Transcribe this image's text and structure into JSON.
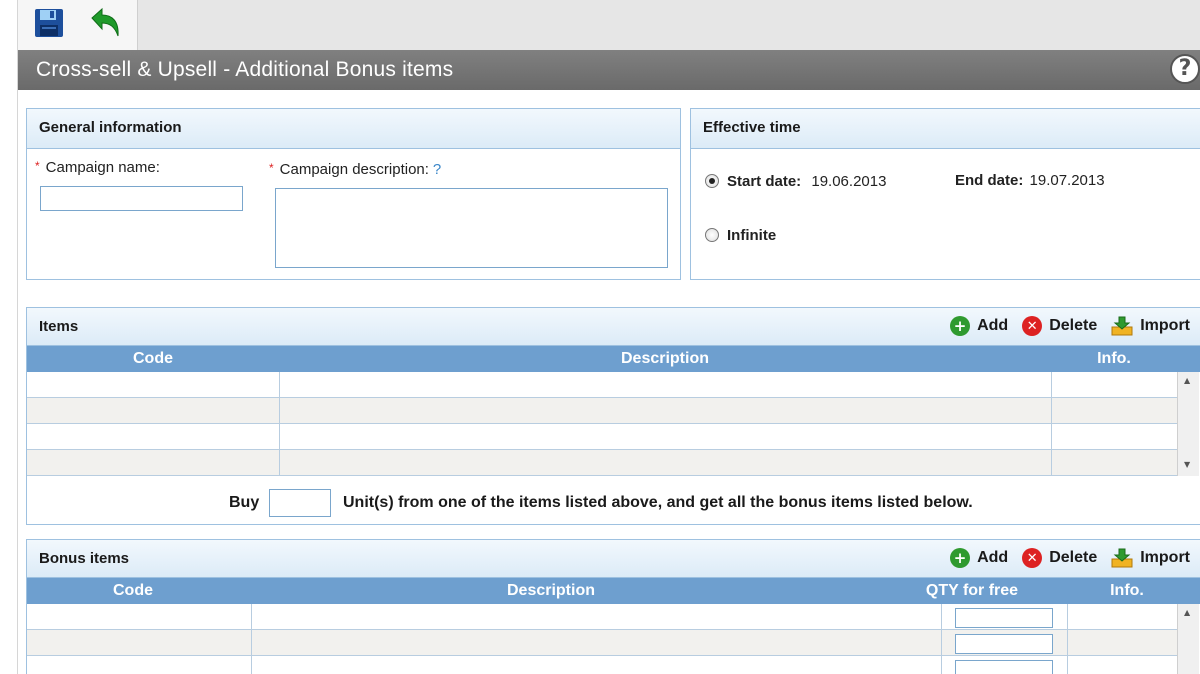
{
  "title": "Cross-sell & Upsell - Additional Bonus items",
  "toolbar": {
    "save_icon": "save-icon",
    "back_icon": "back-arrow-icon"
  },
  "help_label": "?",
  "general": {
    "title": "General information",
    "campaign_name_label": "Campaign name:",
    "campaign_name_value": "",
    "campaign_description_label": "Campaign description:",
    "campaign_description_help": "?",
    "campaign_description_value": "",
    "required_mark": "*"
  },
  "effective": {
    "title": "Effective time",
    "start_label": "Start date:",
    "start_value": "19.06.2013",
    "end_label": "End date:",
    "end_value": "19.07.2013",
    "infinite_label": "Infinite",
    "selected": "start"
  },
  "items": {
    "title": "Items",
    "add_label": "Add",
    "delete_label": "Delete",
    "import_label": "Import",
    "columns": [
      "Code",
      "Description",
      "Info."
    ],
    "rows": [
      [
        "",
        "",
        ""
      ],
      [
        "",
        "",
        ""
      ],
      [
        "",
        "",
        ""
      ],
      [
        "",
        "",
        ""
      ]
    ]
  },
  "buy": {
    "prefix": "Buy",
    "value": "",
    "suffix": "Unit(s) from one of the items listed above, and get all the bonus items listed below."
  },
  "bonus": {
    "title": "Bonus items",
    "add_label": "Add",
    "delete_label": "Delete",
    "import_label": "Import",
    "columns": [
      "Code",
      "Description",
      "QTY for free",
      "Info."
    ],
    "rows": [
      [
        "",
        "",
        "",
        ""
      ],
      [
        "",
        "",
        "",
        ""
      ],
      [
        "",
        "",
        "",
        ""
      ]
    ]
  },
  "colors": {
    "header_blue": "#6e9fcf",
    "title_gray": "#737373",
    "panel_border": "#9ec1e0",
    "required_red": "#dd2222"
  }
}
